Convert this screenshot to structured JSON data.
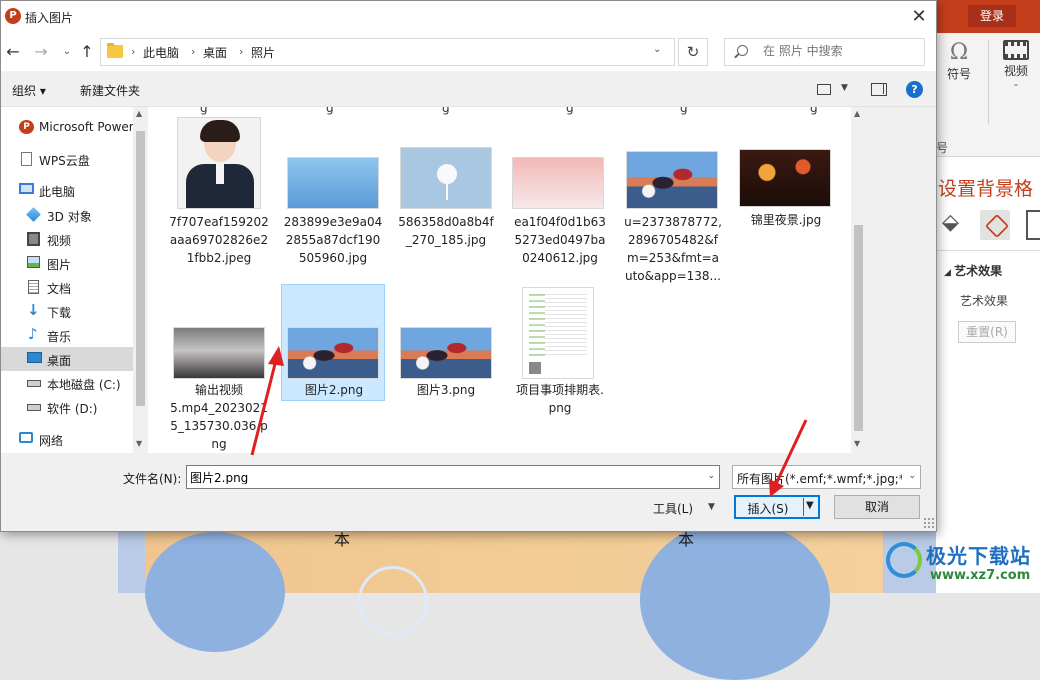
{
  "background_app": {
    "login_label": "登录",
    "ribbon": {
      "symbol_label": "符号",
      "video_label": "视频",
      "group_partial_label": "号"
    },
    "format_pane": {
      "title": "设置背景格",
      "art_effects_heading": "艺术效果",
      "art_effects_sub": "艺术效果",
      "reset_label": "重置(R)"
    },
    "slide_glyph": "本"
  },
  "dialog": {
    "title": "插入图片",
    "app_icon_letter": "P",
    "nav": {
      "breadcrumbs": [
        "此电脑",
        "桌面",
        "照片"
      ],
      "search_placeholder": "在 照片 中搜索"
    },
    "toolbar": {
      "organize_label": "组织 ▾",
      "new_folder_label": "新建文件夹",
      "help_glyph": "?"
    },
    "sidebar": {
      "items": [
        {
          "label": "Microsoft Power",
          "icon": "powerpoint-icon"
        },
        {
          "label": "WPS云盘",
          "icon": "document-icon"
        },
        {
          "label": "此电脑",
          "icon": "computer-icon"
        },
        {
          "label": "3D 对象",
          "icon": "cube-icon"
        },
        {
          "label": "视频",
          "icon": "film-icon"
        },
        {
          "label": "图片",
          "icon": "picture-icon"
        },
        {
          "label": "文档",
          "icon": "document-icon"
        },
        {
          "label": "下载",
          "icon": "download-icon"
        },
        {
          "label": "音乐",
          "icon": "music-icon"
        },
        {
          "label": "桌面",
          "icon": "desktop-icon",
          "selected": true
        },
        {
          "label": "本地磁盘 (C:)",
          "icon": "drive-icon"
        },
        {
          "label": "软件 (D:)",
          "icon": "drive-icon"
        },
        {
          "label": "网络",
          "icon": "network-icon"
        }
      ]
    },
    "partial_row_labels": [
      "g",
      "g",
      "g",
      "g",
      "g",
      "g"
    ],
    "files": [
      {
        "name": "7f707eaf159202aaa69702826e21fbb2.jpeg",
        "lines": [
          "7f707eaf159202",
          "aaa69702826e2",
          "1fbb2.jpeg"
        ],
        "thumb": "portrait"
      },
      {
        "name": "283899e3e9a042855a87dcf190505960.jpg",
        "lines": [
          "283899e3e9a04",
          "2855a87dcf190",
          "505960.jpg"
        ],
        "thumb": "blue-gradient"
      },
      {
        "name": "586358d0a8b4f_270_185.jpg",
        "lines": [
          "586358d0a8b4f",
          "_270_185.jpg"
        ],
        "thumb": "flower"
      },
      {
        "name": "ea1f04f0d1b635273ed0497ba0240612.jpg",
        "lines": [
          "ea1f04f0d1b63",
          "5273ed0497ba",
          "0240612.jpg"
        ],
        "thumb": "pink-gradient"
      },
      {
        "name": "u=2373878772,2896705482&fm=253&fmt=auto&app=138...",
        "lines": [
          "u=2373878772,",
          "2896705482&f",
          "m=253&fmt=a",
          "uto&app=138..."
        ],
        "thumb": "anime"
      },
      {
        "name": "锦里夜景.jpg",
        "lines": [
          "锦里夜景.jpg"
        ],
        "thumb": "night"
      },
      {
        "name": "输出视频5.mp4_20230215_135730.036.png",
        "lines": [
          "输出视频",
          "5.mp4_2023021",
          "5_135730.036.p",
          "ng"
        ],
        "thumb": "sky"
      },
      {
        "name": "图片2.png",
        "lines": [
          "图片2.png"
        ],
        "thumb": "anime",
        "selected": true
      },
      {
        "name": "图片3.png",
        "lines": [
          "图片3.png"
        ],
        "thumb": "anime"
      },
      {
        "name": "项目事项排期表.png",
        "lines": [
          "项目事项排期表.",
          "png"
        ],
        "thumb": "spreadsheet"
      }
    ],
    "bottom": {
      "filename_label": "文件名(N):",
      "filename_value": "图片2.png",
      "filetype_value": "所有图片(*.emf;*.wmf;*.jpg;*.jp",
      "tools_label": "工具(L)",
      "insert_label": "插入(S)",
      "cancel_label": "取消"
    }
  },
  "watermark": {
    "title": "极光下载站",
    "url": "www.xz7.com"
  }
}
